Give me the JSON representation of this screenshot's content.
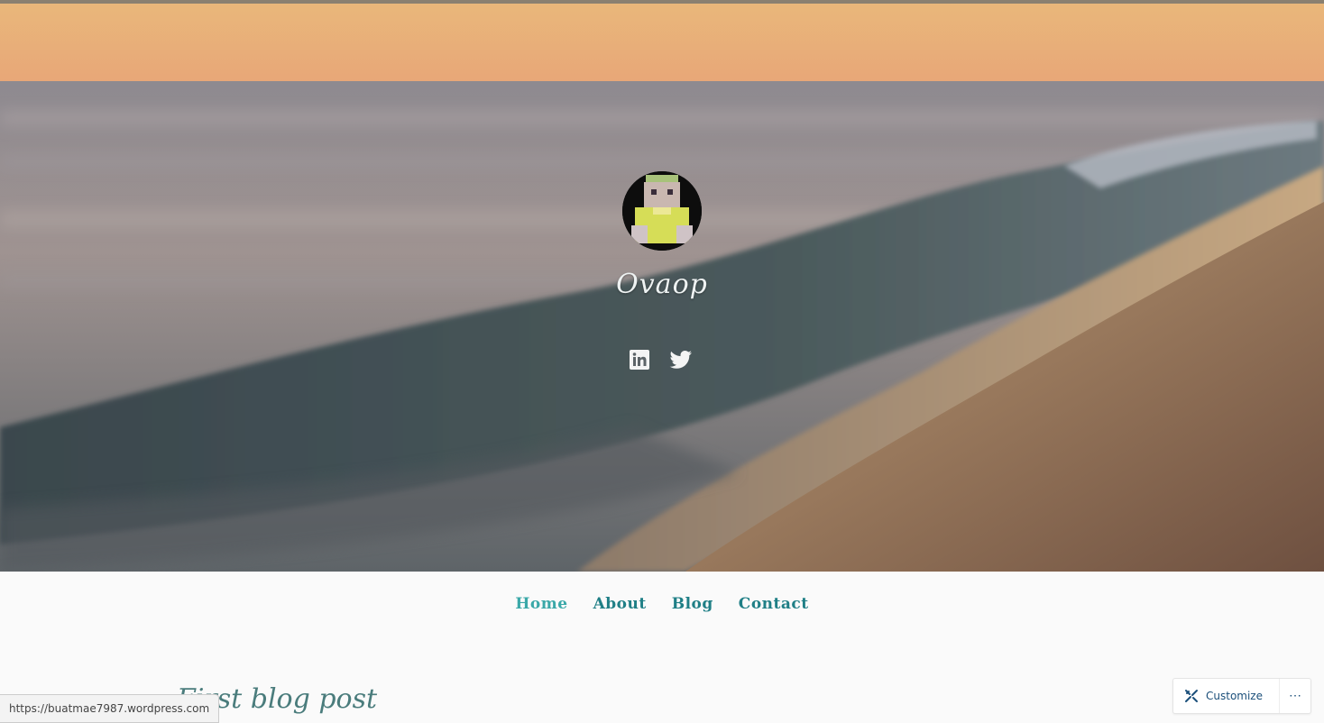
{
  "site": {
    "title": "Ovaop"
  },
  "header": {
    "avatar_alt": "avatar",
    "social": [
      {
        "name": "linkedin-icon"
      },
      {
        "name": "twitter-icon"
      }
    ]
  },
  "nav": {
    "items": [
      {
        "label": "Home"
      },
      {
        "label": "About"
      },
      {
        "label": "Blog"
      },
      {
        "label": "Contact"
      }
    ]
  },
  "main": {
    "post_title": "First blog post"
  },
  "status": {
    "url": "https://buatmae7987.wordpress.com"
  },
  "customizer": {
    "label": "Customize",
    "more": "⋯"
  },
  "colors": {
    "nav_link": "#1f7f86",
    "nav_active": "#3aa8a8",
    "customize_text": "#1b4f7a"
  }
}
